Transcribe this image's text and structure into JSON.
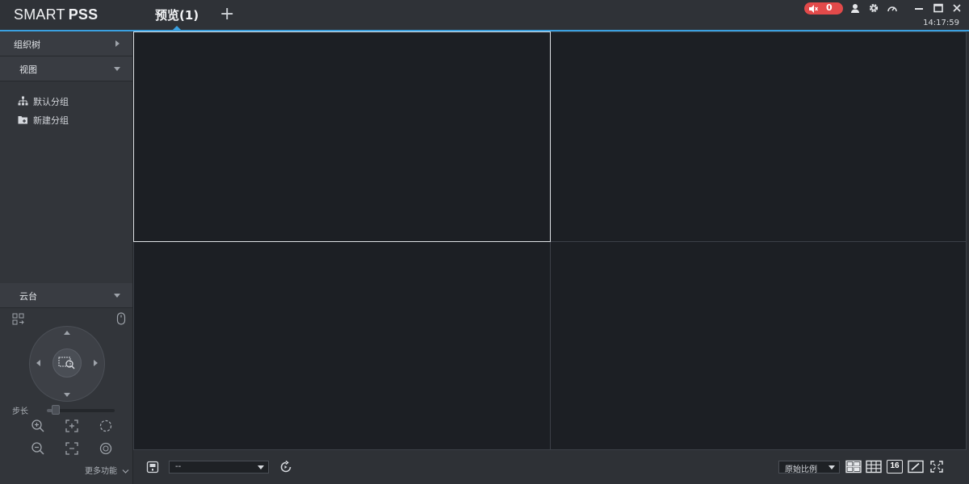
{
  "app": {
    "name_regular": "SMART",
    "name_bold": "PSS"
  },
  "tabs": [
    {
      "label": "预览(1)"
    }
  ],
  "header": {
    "alarm_count": "0",
    "time": "14:17:59"
  },
  "sidebar": {
    "sections": {
      "org_tree": "组织树",
      "view": "视图",
      "ptz": "云台"
    },
    "view_items": [
      {
        "label": "默认分组"
      },
      {
        "label": "新建分组"
      }
    ],
    "ptz": {
      "step_label": "步长",
      "step_level": 0.08,
      "more_label": "更多功能"
    }
  },
  "toolbar": {
    "stream_select": "--",
    "ratio_select": "原始比例",
    "layout_16": "16"
  },
  "colors": {
    "accent": "#3aa0e0",
    "alarm": "#e24a4a",
    "background": "#2b2e33",
    "video_bg": "#1c1f24"
  }
}
